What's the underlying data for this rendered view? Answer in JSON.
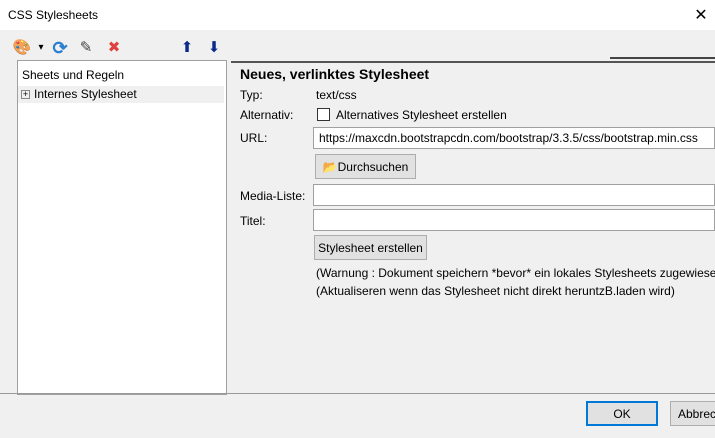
{
  "window": {
    "title": "CSS Stylesheets",
    "close_icon": "close-icon"
  },
  "toolbar": {
    "icons": [
      "palette-icon",
      "dropdown-arrow-icon",
      "refresh-icon",
      "edit-icon",
      "delete-icon",
      "arrow-up-icon",
      "arrow-down-icon"
    ],
    "glyphs": {
      "palette": "🎨",
      "dropdown": "▾",
      "refresh": "⟳",
      "edit": "✎",
      "delete": "✖",
      "up": "⬆",
      "down": "⬇"
    }
  },
  "tree": {
    "header": "Sheets und Regeln",
    "items": [
      {
        "label": "Internes Stylesheet",
        "expander": "+"
      }
    ]
  },
  "form": {
    "heading": "Neues, verlinktes Stylesheet",
    "type_label": "Typ:",
    "type_value": "text/css",
    "alt_label": "Alternativ:",
    "alt_checkbox_label": "Alternatives Stylesheet erstellen",
    "alt_checked": false,
    "url_label": "URL:",
    "url_value": "https://maxcdn.bootstrapcdn.com/bootstrap/3.3.5/css/bootstrap.min.css",
    "browse_label": "Durchsuchen",
    "media_label": "Media-Liste:",
    "media_value": "",
    "title_label": "Titel:",
    "title_value": "",
    "create_label": "Stylesheet erstellen",
    "warning1": "(Warnung : Dokument speichern *bevor* ein lokales Stylesheets zugewiesen",
    "warning2": "(Aktualiseren wenn das Stylesheet nicht direkt heruntzB.laden wird)"
  },
  "footer": {
    "ok_label": "OK",
    "cancel_label": "Abbrechen"
  }
}
